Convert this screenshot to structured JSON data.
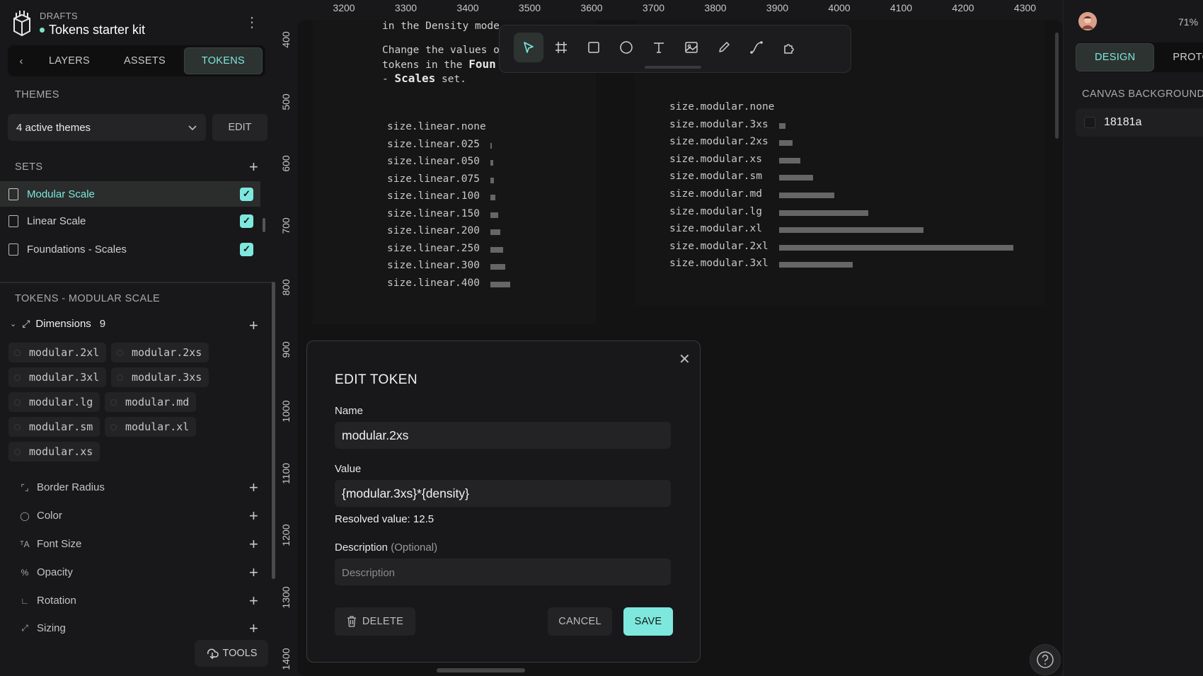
{
  "project": {
    "kicker": "DRAFTS",
    "name": "Tokens starter kit"
  },
  "left_tabs": {
    "back": "‹",
    "items": [
      {
        "label": "LAYERS"
      },
      {
        "label": "ASSETS"
      },
      {
        "label": "TOKENS"
      }
    ]
  },
  "themes": {
    "label": "THEMES",
    "selected": "4 active themes",
    "edit_label": "EDIT"
  },
  "sets": {
    "label": "SETS",
    "items": [
      {
        "label": "Modular Scale",
        "checked": true,
        "active": true
      },
      {
        "label": "Linear Scale",
        "checked": true,
        "active": false
      },
      {
        "label": "Foundations - Scales",
        "checked": true,
        "active": false
      }
    ]
  },
  "tokens": {
    "label": "TOKENS - MODULAR SCALE",
    "group": {
      "label": "Dimensions",
      "count": "9"
    },
    "pills": [
      "modular.2xl",
      "modular.2xs",
      "modular.3xl",
      "modular.3xs",
      "modular.lg",
      "modular.md",
      "modular.sm",
      "modular.xl",
      "modular.xs"
    ],
    "categories": [
      {
        "icon": "border-radius-icon",
        "label": "Border Radius"
      },
      {
        "icon": "color-icon",
        "label": "Color"
      },
      {
        "icon": "font-size-icon",
        "label": "Font Size"
      },
      {
        "icon": "opacity-icon",
        "label": "Opacity"
      },
      {
        "icon": "rotation-icon",
        "label": "Rotation"
      },
      {
        "icon": "sizing-icon",
        "label": "Sizing"
      }
    ]
  },
  "tools_label": "TOOLS",
  "ruler_x": [
    "3200",
    "3300",
    "3400",
    "3500",
    "3600",
    "3700",
    "3800",
    "3900",
    "4000",
    "4100",
    "4200",
    "4300"
  ],
  "ruler_y": [
    "400",
    "500",
    "600",
    "700",
    "800",
    "900",
    "1000",
    "1100",
    "1200",
    "1300",
    "1400"
  ],
  "canvas_text": {
    "line1": "in the Density mode",
    "line2": "Change the values o",
    "line3a": "tokens in the ",
    "line3b": "Foun",
    "line4a": "- ",
    "line4b": "Scales",
    "line4c": " set."
  },
  "linear_tokens": [
    {
      "label": "size.linear.none",
      "value": 0
    },
    {
      "label": "size.linear.025",
      "value": 0.25
    },
    {
      "label": "size.linear.050",
      "value": 0.5
    },
    {
      "label": "size.linear.075",
      "value": 0.75
    },
    {
      "label": "size.linear.100",
      "value": 1
    },
    {
      "label": "size.linear.150",
      "value": 1.5
    },
    {
      "label": "size.linear.200",
      "value": 2
    },
    {
      "label": "size.linear.250",
      "value": 2.5
    },
    {
      "label": "size.linear.300",
      "value": 3
    },
    {
      "label": "size.linear.400",
      "value": 4
    }
  ],
  "modular_tokens": [
    {
      "label": "size.modular.none",
      "value": 0
    },
    {
      "label": "size.modular.3xs",
      "value": 1
    },
    {
      "label": "size.modular.2xs",
      "value": 2.2
    },
    {
      "label": "size.modular.xs",
      "value": 3.5
    },
    {
      "label": "size.modular.sm",
      "value": 5.5
    },
    {
      "label": "size.modular.md",
      "value": 9
    },
    {
      "label": "size.modular.lg",
      "value": 14.5
    },
    {
      "label": "size.modular.xl",
      "value": 23.5
    },
    {
      "label": "size.modular.2xl",
      "value": 38
    },
    {
      "label": "size.modular.3xl",
      "value": 12
    }
  ],
  "toolbar_tools": [
    "select-icon",
    "frame-icon",
    "rectangle-icon",
    "ellipse-icon",
    "text-icon",
    "image-icon",
    "pencil-icon",
    "path-icon",
    "plugin-icon"
  ],
  "right_panel": {
    "zoom": "71%",
    "tabs": [
      {
        "label": "DESIGN"
      },
      {
        "label": "PROTO"
      }
    ],
    "canvas_bg_label": "CANVAS BACKGROUND",
    "canvas_bg_value": "18181a"
  },
  "modal": {
    "title": "EDIT TOKEN",
    "name_label": "Name",
    "name_value": "modular.2xs",
    "value_label": "Value",
    "value_value": "{modular.3xs}*{density}",
    "resolved": "Resolved value: 12.5",
    "desc_label": "Description",
    "desc_optional": "(Optional)",
    "desc_placeholder": "Description",
    "delete_label": "DELETE",
    "cancel_label": "CANCEL",
    "save_label": "SAVE"
  },
  "colors": {
    "accent": "#7ee8de",
    "background": "#18181a",
    "bars": "#666666"
  }
}
